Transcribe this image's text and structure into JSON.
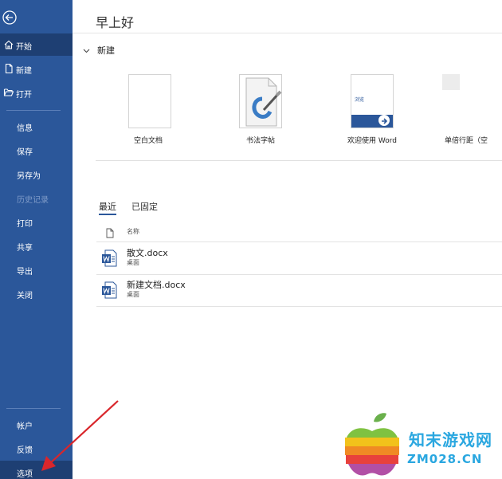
{
  "sidebar": {
    "back": "back-arrow-icon",
    "items": [
      {
        "label": "开始",
        "icon": "home-icon",
        "active": true
      },
      {
        "label": "新建",
        "icon": "new-document-icon"
      },
      {
        "label": "打开",
        "icon": "open-folder-icon"
      },
      {
        "label": "信息"
      },
      {
        "label": "保存"
      },
      {
        "label": "另存为"
      },
      {
        "label": "历史记录",
        "disabled": true
      },
      {
        "label": "打印"
      },
      {
        "label": "共享"
      },
      {
        "label": "导出"
      },
      {
        "label": "关闭"
      }
    ],
    "bottom": [
      {
        "label": "帐户"
      },
      {
        "label": "反馈"
      },
      {
        "label": "选项"
      }
    ]
  },
  "main": {
    "greeting": "早上好",
    "new_section": "新建",
    "templates": [
      {
        "name": "空白文档"
      },
      {
        "name": "书法字帖"
      },
      {
        "name": "欢迎使用 Word",
        "thumb_text": "浏览"
      },
      {
        "name": "单倍行距（空"
      }
    ],
    "tabs": [
      {
        "label": "最近",
        "active": true
      },
      {
        "label": "已固定"
      }
    ],
    "list_header": "名称",
    "files": [
      {
        "name": "散文.docx",
        "location": "桌面"
      },
      {
        "name": "新建文档.docx",
        "location": "桌面"
      }
    ]
  },
  "watermark": {
    "cn": "知末游戏网",
    "en": "ZM028.CN"
  },
  "colors": {
    "sidebar": "#2b579a",
    "sidebar_active": "#1e3f73",
    "accent": "#2b579a",
    "arrow": "#d9262b",
    "watermark": "#2aa7e0"
  }
}
